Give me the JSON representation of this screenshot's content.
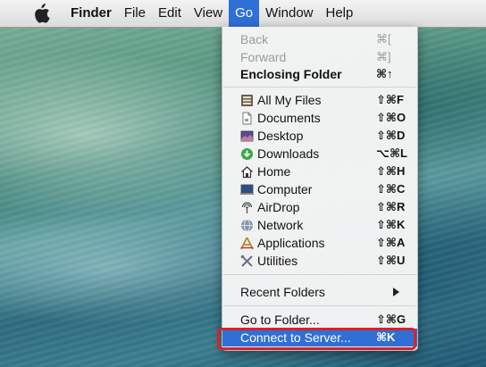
{
  "menubar": {
    "app_name": "Finder",
    "items": [
      "File",
      "Edit",
      "View",
      "Go",
      "Window",
      "Help"
    ]
  },
  "menu": {
    "items": [
      {
        "label": "Back",
        "shortcut": "⌘[",
        "enabled": false
      },
      {
        "label": "Forward",
        "shortcut": "⌘]",
        "enabled": false
      },
      {
        "label": "Enclosing Folder",
        "shortcut": "⌘↑",
        "enabled": true
      },
      {
        "label": "All My Files",
        "shortcut": "⇧⌘F",
        "icon": "all-my-files-icon"
      },
      {
        "label": "Documents",
        "shortcut": "⇧⌘O",
        "icon": "documents-icon"
      },
      {
        "label": "Desktop",
        "shortcut": "⇧⌘D",
        "icon": "desktop-icon"
      },
      {
        "label": "Downloads",
        "shortcut": "⌥⌘L",
        "icon": "downloads-icon"
      },
      {
        "label": "Home",
        "shortcut": "⇧⌘H",
        "icon": "home-icon"
      },
      {
        "label": "Computer",
        "shortcut": "⇧⌘C",
        "icon": "computer-icon"
      },
      {
        "label": "AirDrop",
        "shortcut": "⇧⌘R",
        "icon": "airdrop-icon"
      },
      {
        "label": "Network",
        "shortcut": "⇧⌘K",
        "icon": "network-icon"
      },
      {
        "label": "Applications",
        "shortcut": "⇧⌘A",
        "icon": "applications-icon"
      },
      {
        "label": "Utilities",
        "shortcut": "⇧⌘U",
        "icon": "utilities-icon"
      },
      {
        "label": "Recent Folders",
        "shortcut": "",
        "submenu": true
      },
      {
        "label": "Go to Folder...",
        "shortcut": "⇧⌘G"
      },
      {
        "label": "Connect to Server...",
        "shortcut": "⌘K",
        "highlighted": true
      }
    ]
  },
  "colors": {
    "menu_highlight": "#2f6fd6",
    "callout_outline": "#d7212a"
  }
}
